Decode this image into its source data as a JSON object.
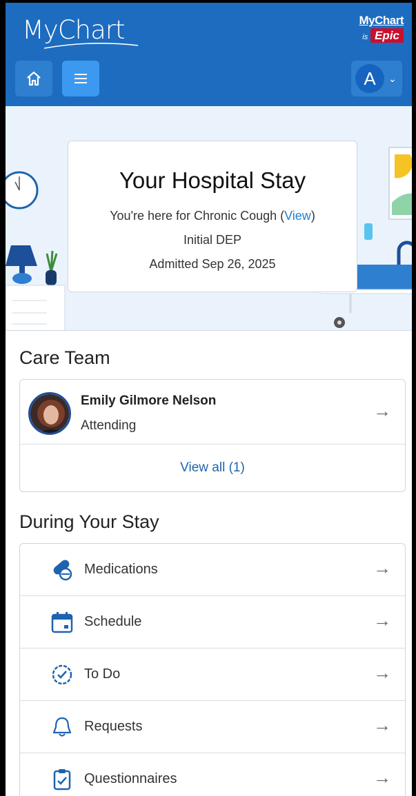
{
  "header": {
    "logo_text": "MyChart",
    "badge_top": "MyChart",
    "badge_is": "is",
    "badge_brand": "Epic",
    "account_initial": "A"
  },
  "hero": {
    "title": "Your Hospital Stay",
    "reason_prefix": "You're here for Chronic Cough (",
    "reason_link": "View",
    "reason_suffix": ")",
    "unit": "Initial DEP",
    "admitted": "Admitted Sep 26, 2025"
  },
  "care_team": {
    "title": "Care Team",
    "members": [
      {
        "name": "Emily Gilmore Nelson",
        "role": "Attending"
      }
    ],
    "view_all": "View all (1)"
  },
  "during_stay": {
    "title": "During Your Stay",
    "items": [
      {
        "label": "Medications",
        "icon": "pill-icon"
      },
      {
        "label": "Schedule",
        "icon": "calendar-icon"
      },
      {
        "label": "To Do",
        "icon": "clock-check-icon"
      },
      {
        "label": "Requests",
        "icon": "bell-icon"
      },
      {
        "label": "Questionnaires",
        "icon": "clipboard-check-icon"
      }
    ]
  },
  "colors": {
    "header": "#1d6cbf",
    "accent": "#1e7fd0",
    "icon": "#1e63b0"
  }
}
